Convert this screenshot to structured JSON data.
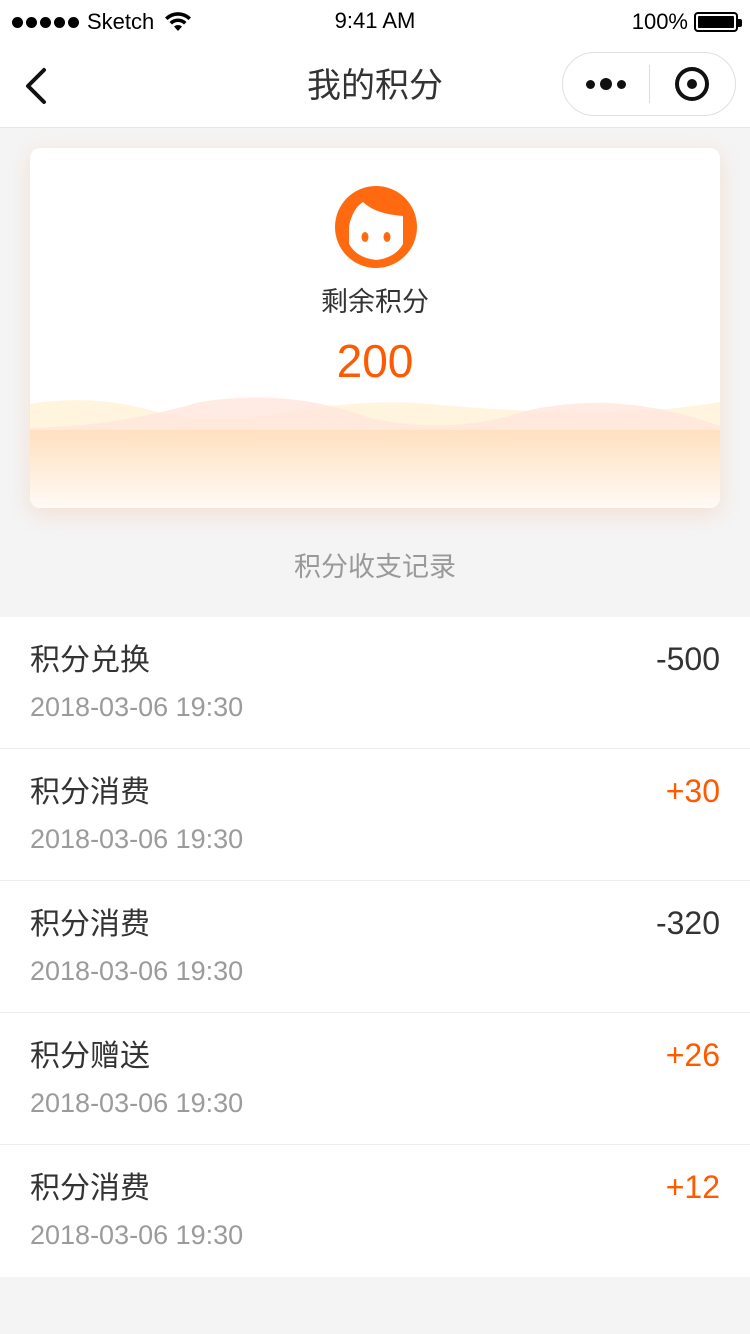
{
  "status_bar": {
    "carrier": "Sketch",
    "time": "9:41 AM",
    "battery": "100%"
  },
  "nav": {
    "title": "我的积分",
    "back_icon": "chevron-left-icon",
    "more_icon": "more-dots-icon",
    "close_icon": "target-circle-icon"
  },
  "card": {
    "label": "剩余积分",
    "value": "200",
    "accent_color": "#ff5a00"
  },
  "records_title": "积分收支记录",
  "records": [
    {
      "title": "积分兑换",
      "date": "2018-03-06 19:30",
      "amount": "-500",
      "positive": false
    },
    {
      "title": "积分消费",
      "date": "2018-03-06 19:30",
      "amount": "+30",
      "positive": true
    },
    {
      "title": "积分消费",
      "date": "2018-03-06 19:30",
      "amount": "-320",
      "positive": false
    },
    {
      "title": "积分赠送",
      "date": "2018-03-06 19:30",
      "amount": "+26",
      "positive": true
    },
    {
      "title": "积分消费",
      "date": "2018-03-06 19:30",
      "amount": "+12",
      "positive": true
    }
  ]
}
